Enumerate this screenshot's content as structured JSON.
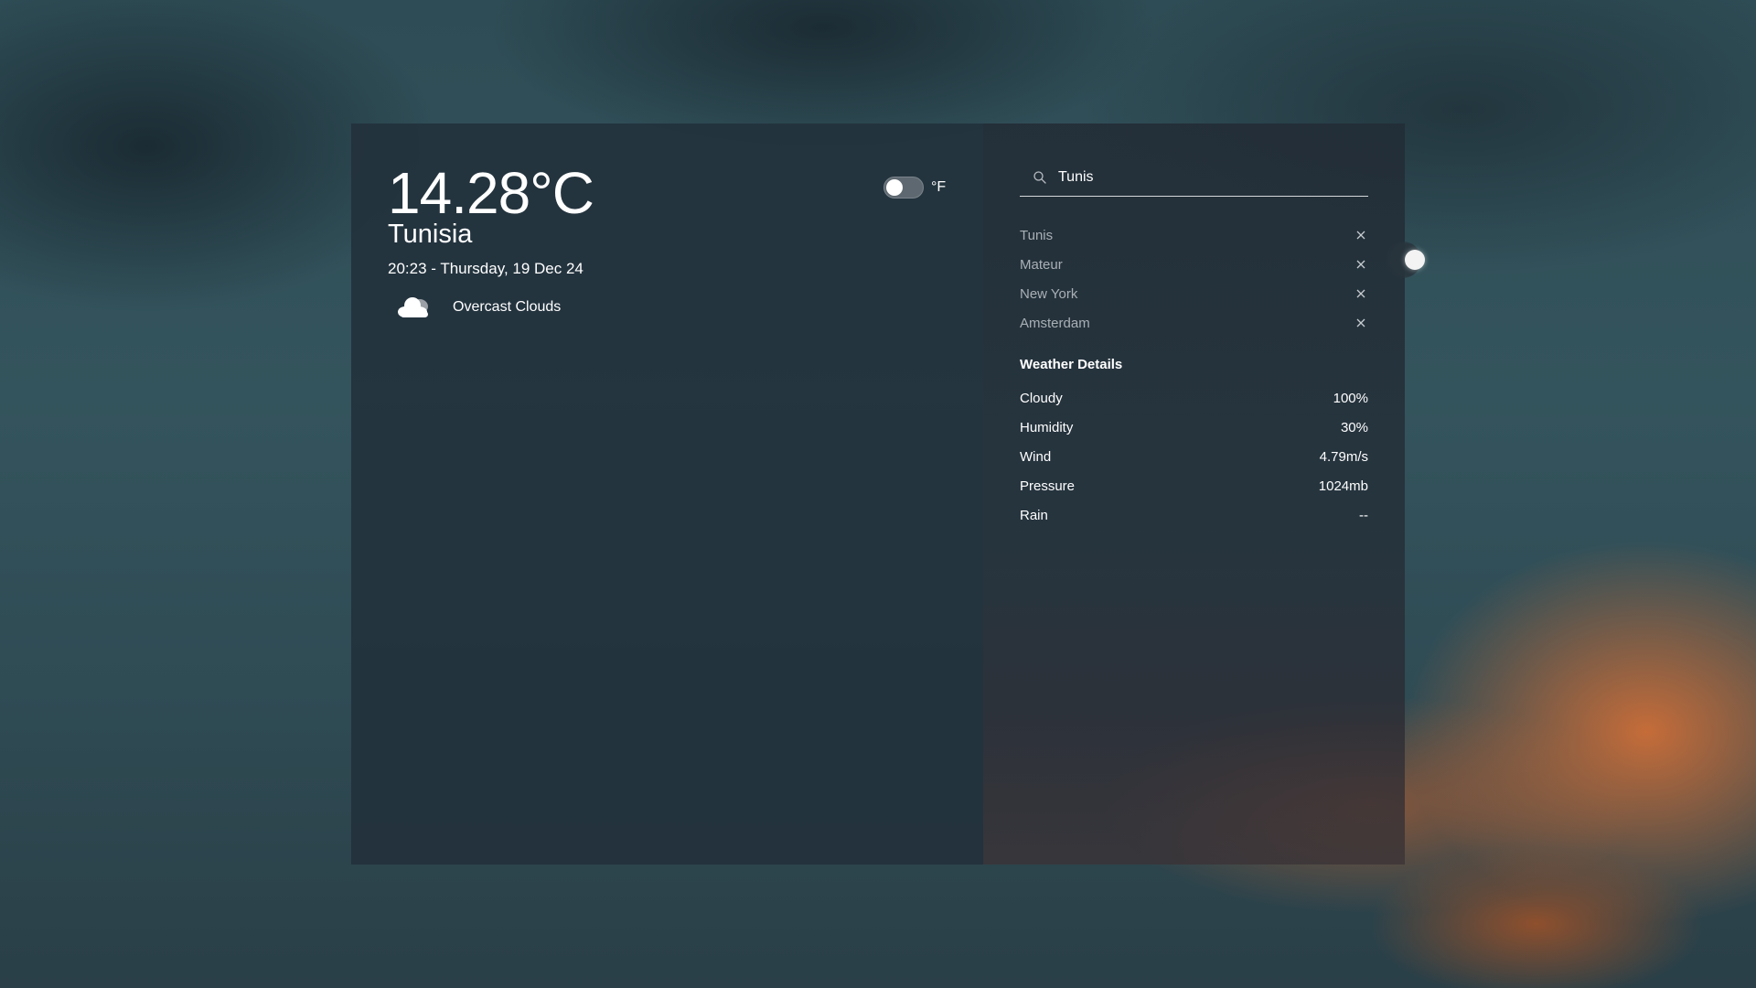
{
  "current": {
    "temperature": "14.28°C",
    "location": "Tunisia",
    "datetime": "20:23 - Thursday, 19 Dec 24",
    "condition": "Overcast Clouds",
    "condition_icon": "cloud-icon"
  },
  "unit_toggle": {
    "label": "°F",
    "checked": false
  },
  "search": {
    "value": "Tunis",
    "icon": "search-icon"
  },
  "history": [
    {
      "city": "Tunis"
    },
    {
      "city": "Mateur"
    },
    {
      "city": "New York"
    },
    {
      "city": "Amsterdam"
    }
  ],
  "details": {
    "title": "Weather Details",
    "rows": [
      {
        "label": "Cloudy",
        "value": "100%"
      },
      {
        "label": "Humidity",
        "value": "30%"
      },
      {
        "label": "Wind",
        "value": "4.79m/s"
      },
      {
        "label": "Pressure",
        "value": "1024mb"
      },
      {
        "label": "Rain",
        "value": "--"
      }
    ]
  },
  "colors": {
    "text": "#ffffff",
    "muted_text": "#a9b0b5",
    "panel": "#22303a",
    "accent_sky_orange": "#d67036"
  }
}
